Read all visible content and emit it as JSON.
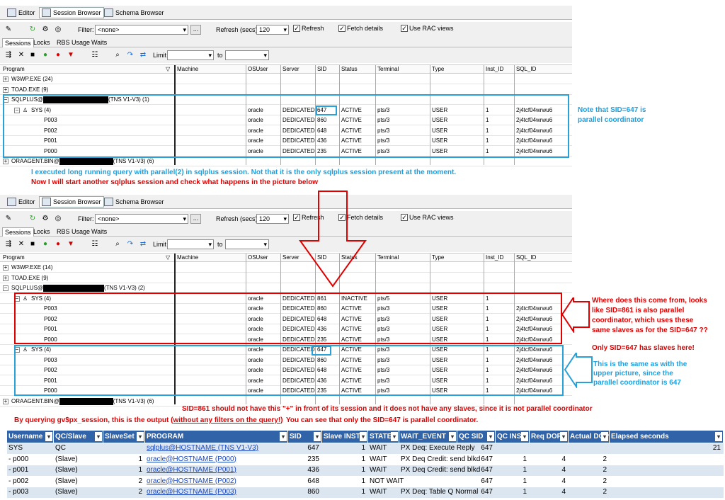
{
  "tabs": {
    "editor": "Editor",
    "session_browser": "Session Browser",
    "schema_browser": "Schema Browser"
  },
  "toolbar": {
    "filter_label": "Filter:",
    "filter_value": "<none>",
    "refresh_label": "Refresh (secs)",
    "refresh_value": "120",
    "refresh_chk": "Refresh",
    "fetch_chk": "Fetch details",
    "rac_chk": "Use RAC views",
    "ellipsis": "..."
  },
  "subtabs": {
    "sessions": "Sessions",
    "locks": "Locks",
    "rbs": "RBS Usage",
    "waits": "Waits"
  },
  "limit": {
    "label": "Limit",
    "to": "to"
  },
  "columns": {
    "program": "Program",
    "machine": "Machine",
    "osuser": "OSUser",
    "server": "Server",
    "sid": "SID",
    "status": "Status",
    "terminal": "Terminal",
    "type": "Type",
    "inst_id": "Inst_ID",
    "sql_id": "SQL_ID"
  },
  "grid1": {
    "w3wp": "W3WP.EXE (24)",
    "toad": "TOAD.EXE (9)",
    "sqlplus_pre": "SQLPLUS@",
    "sqlplus_post": "(TNS V1-V3) (1)",
    "oraagent_pre": "ORAAGENT.BIN@",
    "oraagent_post": "(TNS V1-V3) (6)",
    "sys_label": "SYS (4)",
    "sys": {
      "osuser": "oracle",
      "server": "DEDICATED",
      "sid": "647",
      "status": "ACTIVE",
      "terminal": "pts/3",
      "type": "USER",
      "inst": "1",
      "sql": "2j4tcf04wrwu6"
    },
    "children": [
      {
        "prog": "P003",
        "osuser": "oracle",
        "server": "DEDICATED",
        "sid": "860",
        "status": "ACTIVE",
        "terminal": "pts/3",
        "type": "USER",
        "inst": "1",
        "sql": "2j4tcf04wrwu6"
      },
      {
        "prog": "P002",
        "osuser": "oracle",
        "server": "DEDICATED",
        "sid": "648",
        "status": "ACTIVE",
        "terminal": "pts/3",
        "type": "USER",
        "inst": "1",
        "sql": "2j4tcf04wrwu6"
      },
      {
        "prog": "P001",
        "osuser": "oracle",
        "server": "DEDICATED",
        "sid": "436",
        "status": "ACTIVE",
        "terminal": "pts/3",
        "type": "USER",
        "inst": "1",
        "sql": "2j4tcf04wrwu6"
      },
      {
        "prog": "P000",
        "osuser": "oracle",
        "server": "DEDICATED",
        "sid": "235",
        "status": "ACTIVE",
        "terminal": "pts/3",
        "type": "USER",
        "inst": "1",
        "sql": "2j4tcf04wrwu6"
      }
    ]
  },
  "grid2": {
    "w3wp": "W3WP.EXE (14)",
    "toad": "TOAD.EXE (9)",
    "sqlplus_pre": "SQLPLUS@",
    "sqlplus_post": "(TNS V1-V3) (2)",
    "oraagent_pre": "ORAAGENT.BIN@",
    "oraagent_post": "(TNS V1-V3) (6)",
    "sysA_label": "SYS (4)",
    "sysA": {
      "osuser": "oracle",
      "server": "DEDICATED",
      "sid": "861",
      "status": "INACTIVE",
      "terminal": "pts/5",
      "type": "USER",
      "inst": "1",
      "sql": ""
    },
    "childrenA": [
      {
        "prog": "P003",
        "osuser": "oracle",
        "server": "DEDICATED",
        "sid": "860",
        "status": "ACTIVE",
        "terminal": "pts/3",
        "type": "USER",
        "inst": "1",
        "sql": "2j4tcf04wrwu6"
      },
      {
        "prog": "P002",
        "osuser": "oracle",
        "server": "DEDICATED",
        "sid": "648",
        "status": "ACTIVE",
        "terminal": "pts/3",
        "type": "USER",
        "inst": "1",
        "sql": "2j4tcf04wrwu6"
      },
      {
        "prog": "P001",
        "osuser": "oracle",
        "server": "DEDICATED",
        "sid": "436",
        "status": "ACTIVE",
        "terminal": "pts/3",
        "type": "USER",
        "inst": "1",
        "sql": "2j4tcf04wrwu6"
      },
      {
        "prog": "P000",
        "osuser": "oracle",
        "server": "DEDICATED",
        "sid": "235",
        "status": "ACTIVE",
        "terminal": "pts/3",
        "type": "USER",
        "inst": "1",
        "sql": "2j4tcf04wrwu6"
      }
    ],
    "sysB_label": "SYS (4)",
    "sysB": {
      "osuser": "oracle",
      "server": "DEDICATED",
      "sid": "647",
      "status": "ACTIVE",
      "terminal": "pts/3",
      "type": "USER",
      "inst": "1",
      "sql": "2j4tcf04wrwu6"
    },
    "childrenB": [
      {
        "prog": "P003",
        "osuser": "oracle",
        "server": "DEDICATED",
        "sid": "860",
        "status": "ACTIVE",
        "terminal": "pts/3",
        "type": "USER",
        "inst": "1",
        "sql": "2j4tcf04wrwu6"
      },
      {
        "prog": "P002",
        "osuser": "oracle",
        "server": "DEDICATED",
        "sid": "648",
        "status": "ACTIVE",
        "terminal": "pts/3",
        "type": "USER",
        "inst": "1",
        "sql": "2j4tcf04wrwu6"
      },
      {
        "prog": "P001",
        "osuser": "oracle",
        "server": "DEDICATED",
        "sid": "436",
        "status": "ACTIVE",
        "terminal": "pts/3",
        "type": "USER",
        "inst": "1",
        "sql": "2j4tcf04wrwu6"
      },
      {
        "prog": "P000",
        "osuser": "oracle",
        "server": "DEDICATED",
        "sid": "235",
        "status": "ACTIVE",
        "terminal": "pts/3",
        "type": "USER",
        "inst": "1",
        "sql": "2j4tcf04wrwu6"
      }
    ]
  },
  "notes": {
    "n1": "Note that SID=647 is",
    "n1b": "parallel coordinator",
    "n2": "I executed long running query with parallel(2) in sqlplus session. Not that it is the only sqlplus session present at the moment.",
    "n3": "Now I will start another sqlplus session and check what happens in the picture below",
    "n4": [
      "Where does this come from, looks",
      "like SID=861 is also parallel",
      "coordinator, which uses these",
      "same slaves as for the SID=647 ??"
    ],
    "n5": "Only SID=647 has slaves here!",
    "n6": [
      "This is the same as with the",
      "upper picture, since the",
      "parallel coordinator is 647"
    ],
    "n7": "SID=861 should not have this \"+\" in front of its session and it does not have any  slaves, since it is not parallel coordinator",
    "n8_pre": "By querying gv$px_session, this is the output (",
    "n8_u": "without any filters on the query!",
    "n8_post": ")",
    "n9": "You can see that only the SID=647 is parallel coordinator."
  },
  "px": {
    "headers": [
      "Username",
      "QC/Slave",
      "SlaveSet",
      "PROGRAM",
      "SID",
      "Slave INST",
      "STATE",
      "WAIT_EVENT",
      "QC SID",
      "QC INST",
      "Req DOP",
      "Actual DOP",
      "Elapsed seconds"
    ],
    "rows": [
      [
        "SYS",
        "QC",
        "",
        "sqlplus@HOSTNAME (TNS V1-V3)",
        "647",
        "1",
        "WAIT",
        "PX Deq: Execute Reply",
        "647",
        "",
        "",
        "",
        "21"
      ],
      [
        "- p000",
        "(Slave)",
        "1",
        "oracle@HOSTNAME (P000)",
        "235",
        "1",
        "WAIT",
        "PX Deq Credit: send blkd",
        "647",
        "1",
        "4",
        "2",
        ""
      ],
      [
        "- p001",
        "(Slave)",
        "1",
        "oracle@HOSTNAME (P001)",
        "436",
        "1",
        "WAIT",
        "PX Deq Credit: send blkd",
        "647",
        "1",
        "4",
        "2",
        ""
      ],
      [
        "- p002",
        "(Slave)",
        "2",
        "oracle@HOSTNAME (P002)",
        "648",
        "1",
        "NOT WAIT",
        "",
        "647",
        "1",
        "4",
        "2",
        ""
      ],
      [
        "- p003",
        "(Slave)",
        "2",
        "oracle@HOSTNAME (P003)",
        "860",
        "1",
        "WAIT",
        "PX Deq: Table Q Normal",
        "647",
        "1",
        "4",
        "2",
        ""
      ]
    ]
  }
}
